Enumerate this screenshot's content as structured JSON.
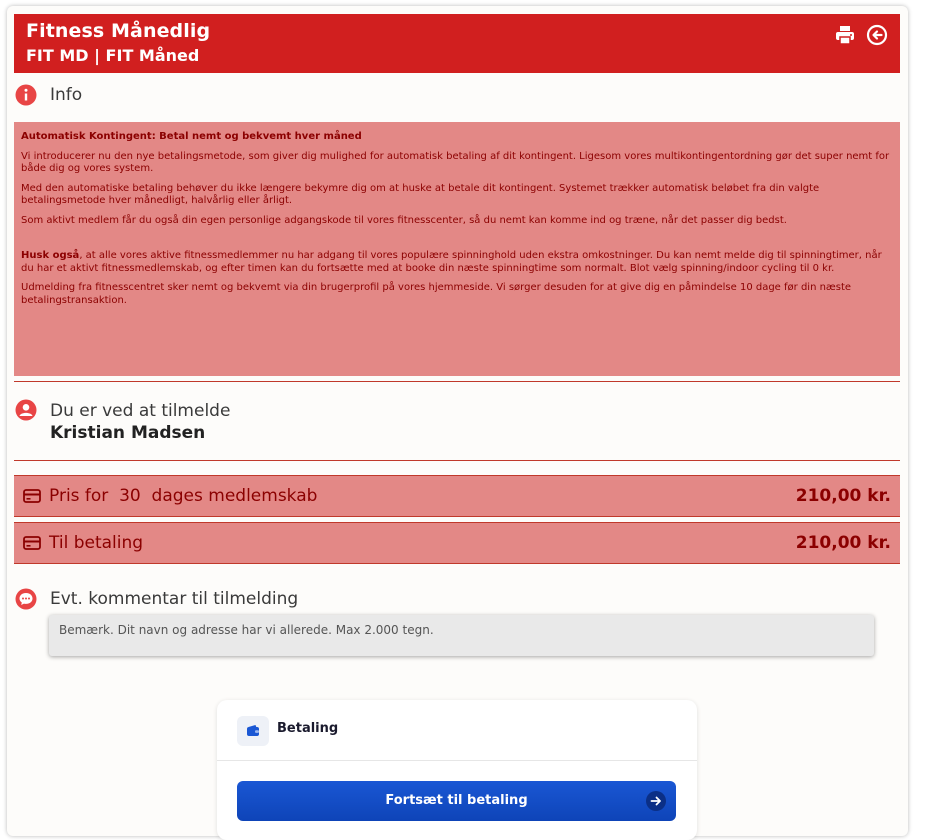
{
  "header": {
    "title": "Fitness Månedlig",
    "subtitle": "FIT MD | FIT Måned",
    "print_icon": "printer-icon",
    "back_icon": "back-arrow-circle-icon"
  },
  "info": {
    "label": "Info",
    "icon": "info-icon",
    "heading": "Automatisk Kontingent: Betal nemt og bekvemt hver måned",
    "p1": "Vi introducerer nu den nye betalingsmetode, som giver dig mulighed for automatisk betaling af dit kontingent. Ligesom vores multikontingentordning gør det super nemt for både dig og vores system.",
    "p2": "Med den automatiske betaling behøver du ikke længere bekymre dig om at huske at betale dit kontingent. Systemet trækker automatisk beløbet fra din valgte betalingsmetode hver månedligt, halvårlig eller årligt.",
    "p3": "Som aktivt medlem får du også din egen personlige adgangskode til vores fitnesscenter, så du nemt kan komme ind og træne, når det passer dig bedst.",
    "p4_bold": "Husk også",
    "p4_rest": ", at alle vores aktive fitnessmedlemmer nu har adgang til vores populære spinninghold uden ekstra omkostninger. Du kan nemt melde dig til spinningtimer, når du har et aktivt fitnessmedlemskab, og efter timen kan du fortsætte med at booke din næste spinningtime som normalt. Blot vælg spinning/indoor cycling til 0 kr.",
    "p5": "Udmelding fra fitnesscentret sker nemt og bekvemt via din brugerprofil på vores hjemmeside. Vi sørger desuden for at give dig en påmindelse 10 dage før din næste betalingstransaktion."
  },
  "registration": {
    "label": "Du er ved at tilmelde",
    "name": "Kristian Madsen",
    "icon": "user-icon"
  },
  "pricing": {
    "membership_label": "Pris for  30  dages medlemskab",
    "membership_amount": "210,00 kr.",
    "total_label": "Til betaling",
    "total_amount": "210,00 kr.",
    "icon": "credit-card-icon"
  },
  "comment": {
    "label": "Evt. kommentar til tilmelding",
    "placeholder": "Bemærk. Dit navn og adresse har vi allerede. Max 2.000 tegn.",
    "icon": "chat-bubble-icon"
  },
  "payment": {
    "title": "Betaling",
    "icon": "wallet-icon",
    "button_label": "Fortsæt til betaling",
    "button_icon": "arrow-right-icon"
  },
  "colors": {
    "brand_red": "#d11f1f",
    "info_bg": "#e38886",
    "text_dark_red": "#8b0000",
    "button_blue": "#1450c8"
  }
}
